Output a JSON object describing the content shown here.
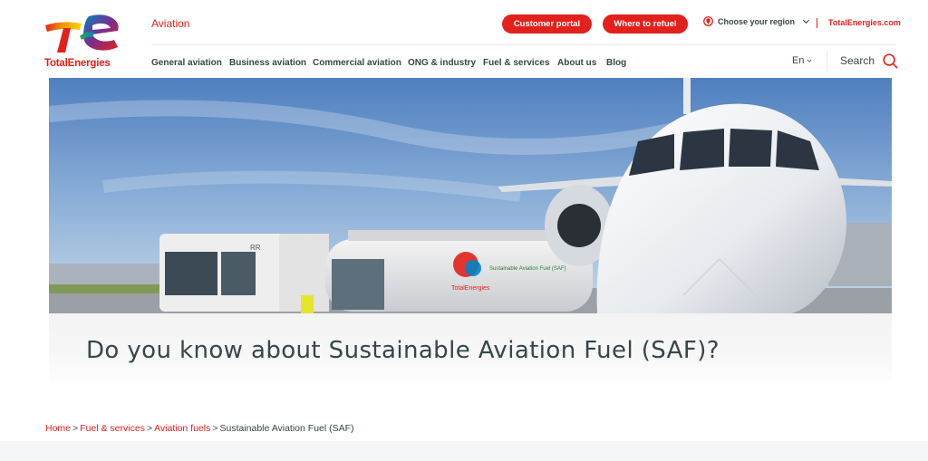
{
  "brand": {
    "logo_text": "TotalEnergies",
    "accent": "#e2211c"
  },
  "header": {
    "section_label": "Aviation",
    "customer_portal": "Customer portal",
    "where_to_refuel": "Where to refuel",
    "region_label": "Choose your region",
    "site_link": "TotalEnergies.com",
    "language": "En",
    "search_label": "Search"
  },
  "nav": {
    "items": [
      {
        "label": "General aviation"
      },
      {
        "label": "Business aviation"
      },
      {
        "label": "Commercial aviation"
      },
      {
        "label": "ONG & industry"
      },
      {
        "label": "Fuel & services"
      },
      {
        "label": "About us"
      },
      {
        "label": "Blog"
      }
    ]
  },
  "hero": {
    "title": "Do you know about Sustainable Aviation Fuel (SAF)?",
    "tanker_brand": "TotalEnergies",
    "tanker_text": "Sustainable Aviation Fuel (SAF)",
    "truck_plate": "RR"
  },
  "breadcrumb": {
    "home": "Home",
    "level1": "Fuel & services",
    "level2": "Aviation fuels",
    "current": "Sustainable Aviation Fuel (SAF)",
    "separator": ">"
  }
}
